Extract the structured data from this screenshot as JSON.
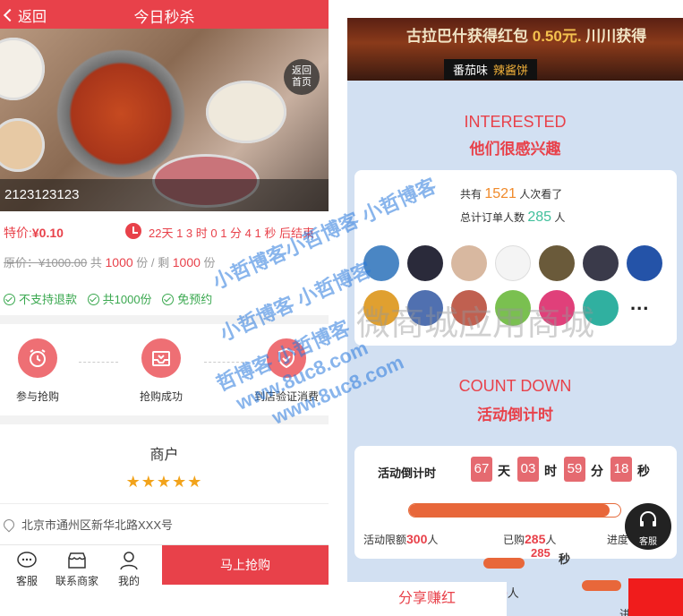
{
  "left": {
    "header": {
      "back_label": "返回",
      "title": "今日秒杀"
    },
    "hero": {
      "home_label_1": "返回",
      "home_label_2": "首页",
      "caption": "2123123123"
    },
    "price": {
      "label": "特价:",
      "value": "¥0.10",
      "countdown": "22天 1 3 时 0 1 分 4 1 秒 后结束"
    },
    "original": {
      "label": "原价：¥1000.00",
      "total_prefix": "共",
      "total": "1000",
      "mid": "份 / 剩",
      "remain": "1000",
      "unit": "份"
    },
    "tags": [
      "不支持退款",
      "共1000份",
      "免预约"
    ],
    "steps": [
      {
        "label": "参与抢购",
        "icon": "alarm-icon"
      },
      {
        "label": "抢购成功",
        "icon": "inbox-icon"
      },
      {
        "label": "到店验证消费",
        "icon": "shield-check-icon"
      }
    ],
    "merchant": {
      "title": "商户",
      "rating": 5,
      "address": "北京市通州区新华北路XXX号"
    },
    "bottom": {
      "service": "客服",
      "contact": "联系商家",
      "mine": "我的",
      "buy": "马上抢购"
    }
  },
  "right": {
    "banner": {
      "prefix": "古拉巴什获得红包",
      "amount": "0.50元.",
      "suffix": "川川获得",
      "flavor": "番茄味",
      "flavor_alt": "辣酱饼"
    },
    "interested": {
      "en": "INTERESTED",
      "cn": "他们很感兴趣",
      "viewed_prefix": "共有",
      "viewed": "1521",
      "viewed_suffix": "人次看了",
      "orders_prefix": "总计订单人数",
      "orders": "285",
      "orders_suffix": "人",
      "more": "..."
    },
    "countdown": {
      "en": "COUNT DOWN",
      "cn": "活动倒计时",
      "label": "活动倒计时",
      "days": "67",
      "day_unit": "天",
      "hours": "03",
      "hour_unit": "时",
      "minutes": "59",
      "minute_unit": "分",
      "seconds": "18",
      "second_unit": "秒",
      "limit_label": "活动限额",
      "limit": "300",
      "limit_unit": "人",
      "sold_label": "已购",
      "sold": "285",
      "sold_unit": "人",
      "progress_label": "进度",
      "progress": 0.95
    },
    "ghost": {
      "seconds": "285",
      "sec_unit": "秒",
      "limit_tail": "活",
      "limit": "300",
      "limit_unit": "人",
      "progress_tail": "进度"
    },
    "service_label": "客服",
    "share": "分享赚红",
    "colors": {
      "accent": "#e8414a",
      "bg": "#d2e0f2"
    }
  },
  "watermark": {
    "line1": "小哲博客小哲博客 小哲博客",
    "line2": "小哲博客 小哲博客",
    "line3": "哲博客 小哲博客",
    "url": "www.8uc8.com",
    "overlay": "微商城应用商城"
  }
}
